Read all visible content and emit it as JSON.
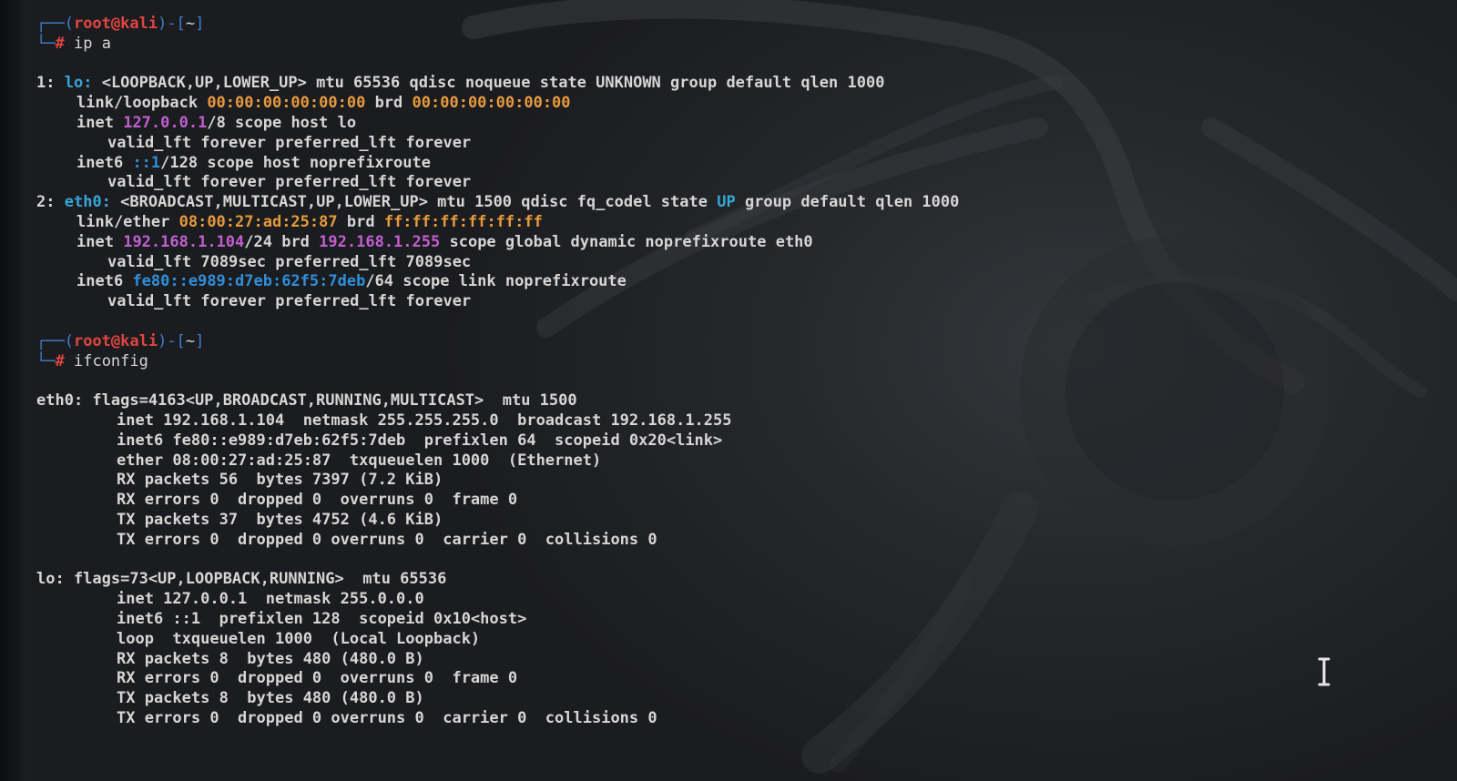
{
  "prompt": {
    "user": "root",
    "at": "@",
    "host": "kali",
    "dir": "~",
    "frame_top_left": "┌──(",
    "frame_mid": ")-[",
    "frame_end": "]",
    "frame_bottom": "└─",
    "hash": "#"
  },
  "commands": {
    "first": "ip a",
    "second": "ifconfig"
  },
  "ip_a": {
    "if1": {
      "index": "1:",
      "name": "lo:",
      "flags": "<LOOPBACK,UP,LOWER_UP> mtu 65536 qdisc noqueue state UNKNOWN group default qlen 1000",
      "link_label": "link/loopback",
      "link_mac": "00:00:00:00:00:00",
      "brd_label": "brd",
      "brd_mac": "00:00:00:00:00:00",
      "inet_label": "inet",
      "inet_addr": "127.0.0.1",
      "inet_rest": "/8 scope host lo",
      "valid1": "valid_lft forever preferred_lft forever",
      "inet6_label": "inet6",
      "inet6_addr": "::1",
      "inet6_rest": "/128 scope host noprefixroute",
      "valid2": "valid_lft forever preferred_lft forever"
    },
    "if2": {
      "index": "2:",
      "name": "eth0:",
      "flags_before": "<BROADCAST,MULTICAST,UP,LOWER_UP> mtu 1500 qdisc fq_codel state",
      "state": "UP",
      "flags_after": "group default qlen 1000",
      "link_label": "link/ether",
      "link_mac": "08:00:27:ad:25:87",
      "brd_label": "brd",
      "brd_mac": "ff:ff:ff:ff:ff:ff",
      "inet_label": "inet",
      "inet_addr": "192.168.1.104",
      "inet_mid": "/24 brd",
      "inet_brd": "192.168.1.255",
      "inet_rest": "scope global dynamic noprefixroute eth0",
      "valid1": "valid_lft 7089sec preferred_lft 7089sec",
      "inet6_label": "inet6",
      "inet6_addr": "fe80::e989:d7eb:62f5:7deb",
      "inet6_rest": "/64 scope link noprefixroute",
      "valid2": "valid_lft forever preferred_lft forever"
    }
  },
  "ifconfig": {
    "eth0": [
      "eth0: flags=4163<UP,BROADCAST,RUNNING,MULTICAST>  mtu 1500",
      "inet 192.168.1.104  netmask 255.255.255.0  broadcast 192.168.1.255",
      "inet6 fe80::e989:d7eb:62f5:7deb  prefixlen 64  scopeid 0x20<link>",
      "ether 08:00:27:ad:25:87  txqueuelen 1000  (Ethernet)",
      "RX packets 56  bytes 7397 (7.2 KiB)",
      "RX errors 0  dropped 0  overruns 0  frame 0",
      "TX packets 37  bytes 4752 (4.6 KiB)",
      "TX errors 0  dropped 0 overruns 0  carrier 0  collisions 0"
    ],
    "lo": [
      "lo: flags=73<UP,LOOPBACK,RUNNING>  mtu 65536",
      "inet 127.0.0.1  netmask 255.0.0.0",
      "inet6 ::1  prefixlen 128  scopeid 0x10<host>",
      "loop  txqueuelen 1000  (Local Loopback)",
      "RX packets 8  bytes 480 (480.0 B)",
      "RX errors 0  dropped 0  overruns 0  frame 0",
      "TX packets 8  bytes 480 (480.0 B)",
      "TX errors 0  dropped 0 overruns 0  carrier 0  collisions 0"
    ]
  },
  "colors": {
    "background": "#26282c",
    "text": "#d6d6d4",
    "prompt_red": "#e0453f",
    "prompt_blue": "#3e7fd1",
    "iface_cyan": "#35a7d8",
    "mac_orange": "#e79a3c",
    "ipv4_purple": "#c25fd0",
    "ipv6_blue": "#2f8fd8"
  },
  "icons": {
    "cursor": "text-ibeam-cursor",
    "wallpaper": "kali-dragon-logo"
  }
}
